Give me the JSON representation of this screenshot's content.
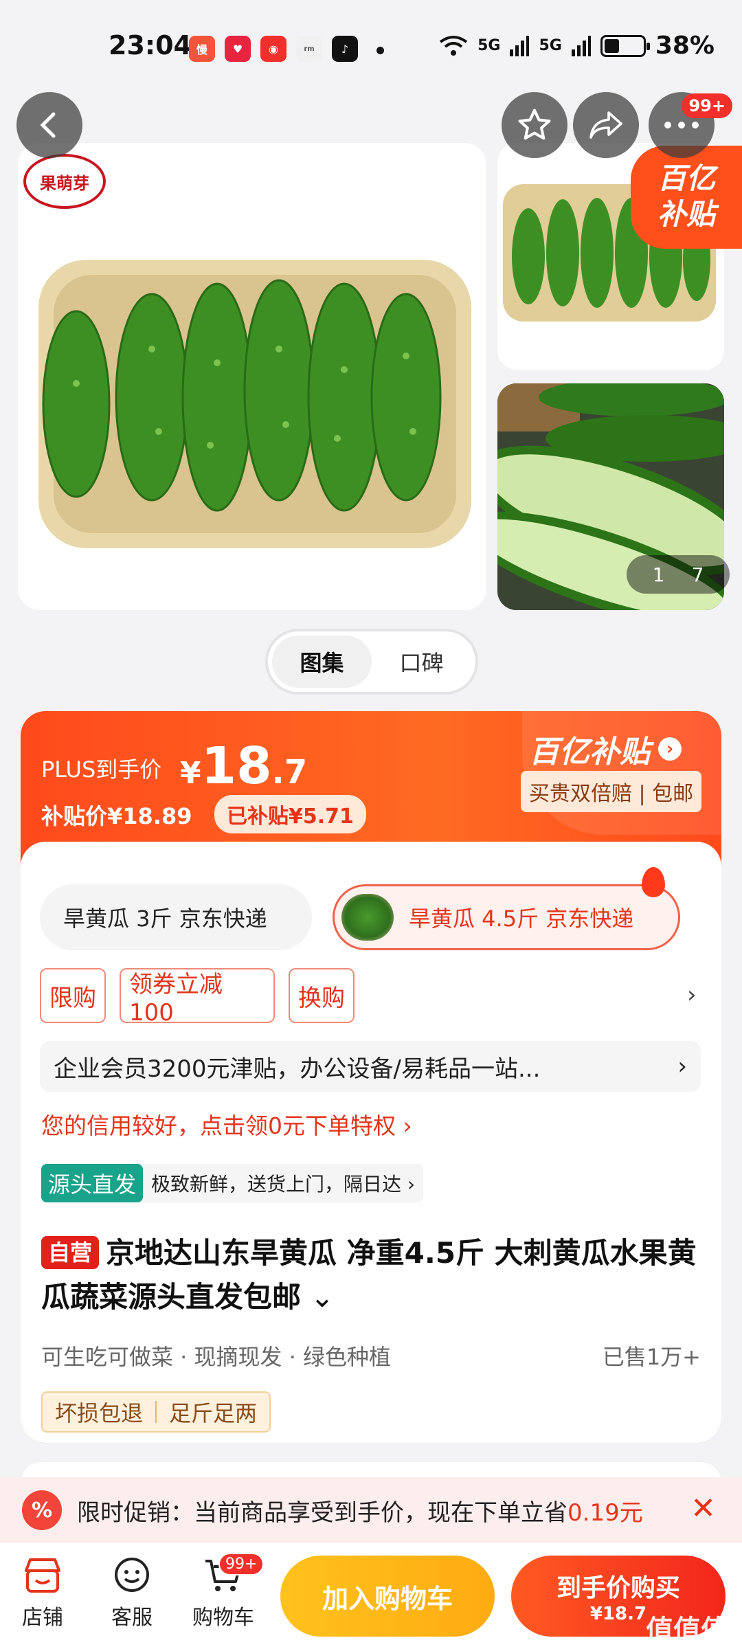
{
  "status_bar": {
    "time": "23:04",
    "network1": "5G",
    "network2": "5G",
    "battery": "38%"
  },
  "gallery": {
    "brand_stamp": "果萌芽",
    "counter_current": "1",
    "counter_total": "7",
    "subsidy_corner_line1": "百亿",
    "subsidy_corner_line2": "补贴",
    "more_badge": "99+"
  },
  "tabs": [
    {
      "label": "图集"
    },
    {
      "label": "口碑"
    }
  ],
  "price": {
    "plus_label": "PLUS到手价",
    "currency": "¥",
    "price_int": "18",
    "price_dec": ".7",
    "subsidy_price": "补贴价¥18.89",
    "subsidized": "已补贴¥5.71",
    "program": "百亿补贴",
    "program_tag": "买贵双倍赔 | 包邮"
  },
  "specs": [
    {
      "label": "旱黄瓜 3斤 京东快递"
    },
    {
      "label": "旱黄瓜 4.5斤 京东快递"
    }
  ],
  "promos": [
    {
      "label": "限购"
    },
    {
      "label": "领券立减100"
    },
    {
      "label": "换购"
    }
  ],
  "business": {
    "text": "企业会员3200元津贴，办公设备/易耗品一站..."
  },
  "credit": {
    "text": "您的信用较好，点击领0元下单特权 ›"
  },
  "source": {
    "tag": "源头直发",
    "text": "极致新鲜，送货上门，隔日达 ›"
  },
  "product": {
    "self_tag": "自营",
    "title": "京地达山东旱黄瓜 净重4.5斤 大刺黄瓜水果黄瓜蔬菜源头直发包邮",
    "features": "可生吃可做菜 · 现摘现发 · 绿色种植",
    "sold": "已售1万+",
    "guarantees": [
      "坏损包退",
      "足斤足两"
    ]
  },
  "promo_strip": {
    "text": "限时促销：当前商品享受到手价，现在下单立省",
    "amount": "0.19元"
  },
  "bottom_bar": {
    "store": "店铺",
    "service": "客服",
    "cart": "购物车",
    "cart_badge": "99+",
    "add_to_cart": "加入购物车",
    "buy_line1": "到手价购买",
    "buy_line2": "¥18.7"
  },
  "watermark": "值值值",
  "colors": {
    "accent": "#ff4a1c",
    "cart_button": "#ffb218",
    "source_tag": "#19a38a"
  }
}
